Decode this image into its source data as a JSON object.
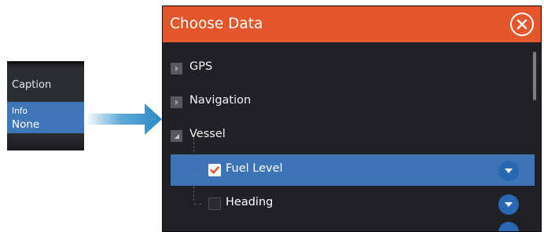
{
  "caption_widget": {
    "caption_label": "Caption",
    "info_label": "Info",
    "info_value": "None"
  },
  "dialog": {
    "title": "Choose Data",
    "close_icon": "close-circle-icon",
    "items": [
      {
        "label": "GPS",
        "state": "collapsed"
      },
      {
        "label": "Navigation",
        "state": "collapsed"
      },
      {
        "label": "Vessel",
        "state": "expanded"
      }
    ],
    "vessel_children": [
      {
        "label": "Fuel Level",
        "checked": true,
        "selected": true
      },
      {
        "label": "Heading",
        "checked": false,
        "selected": false
      }
    ]
  },
  "colors": {
    "header": "#e4562c",
    "selection": "#3c74b6",
    "accent_button": "#2867b2",
    "checkmark": "#e4562c"
  }
}
